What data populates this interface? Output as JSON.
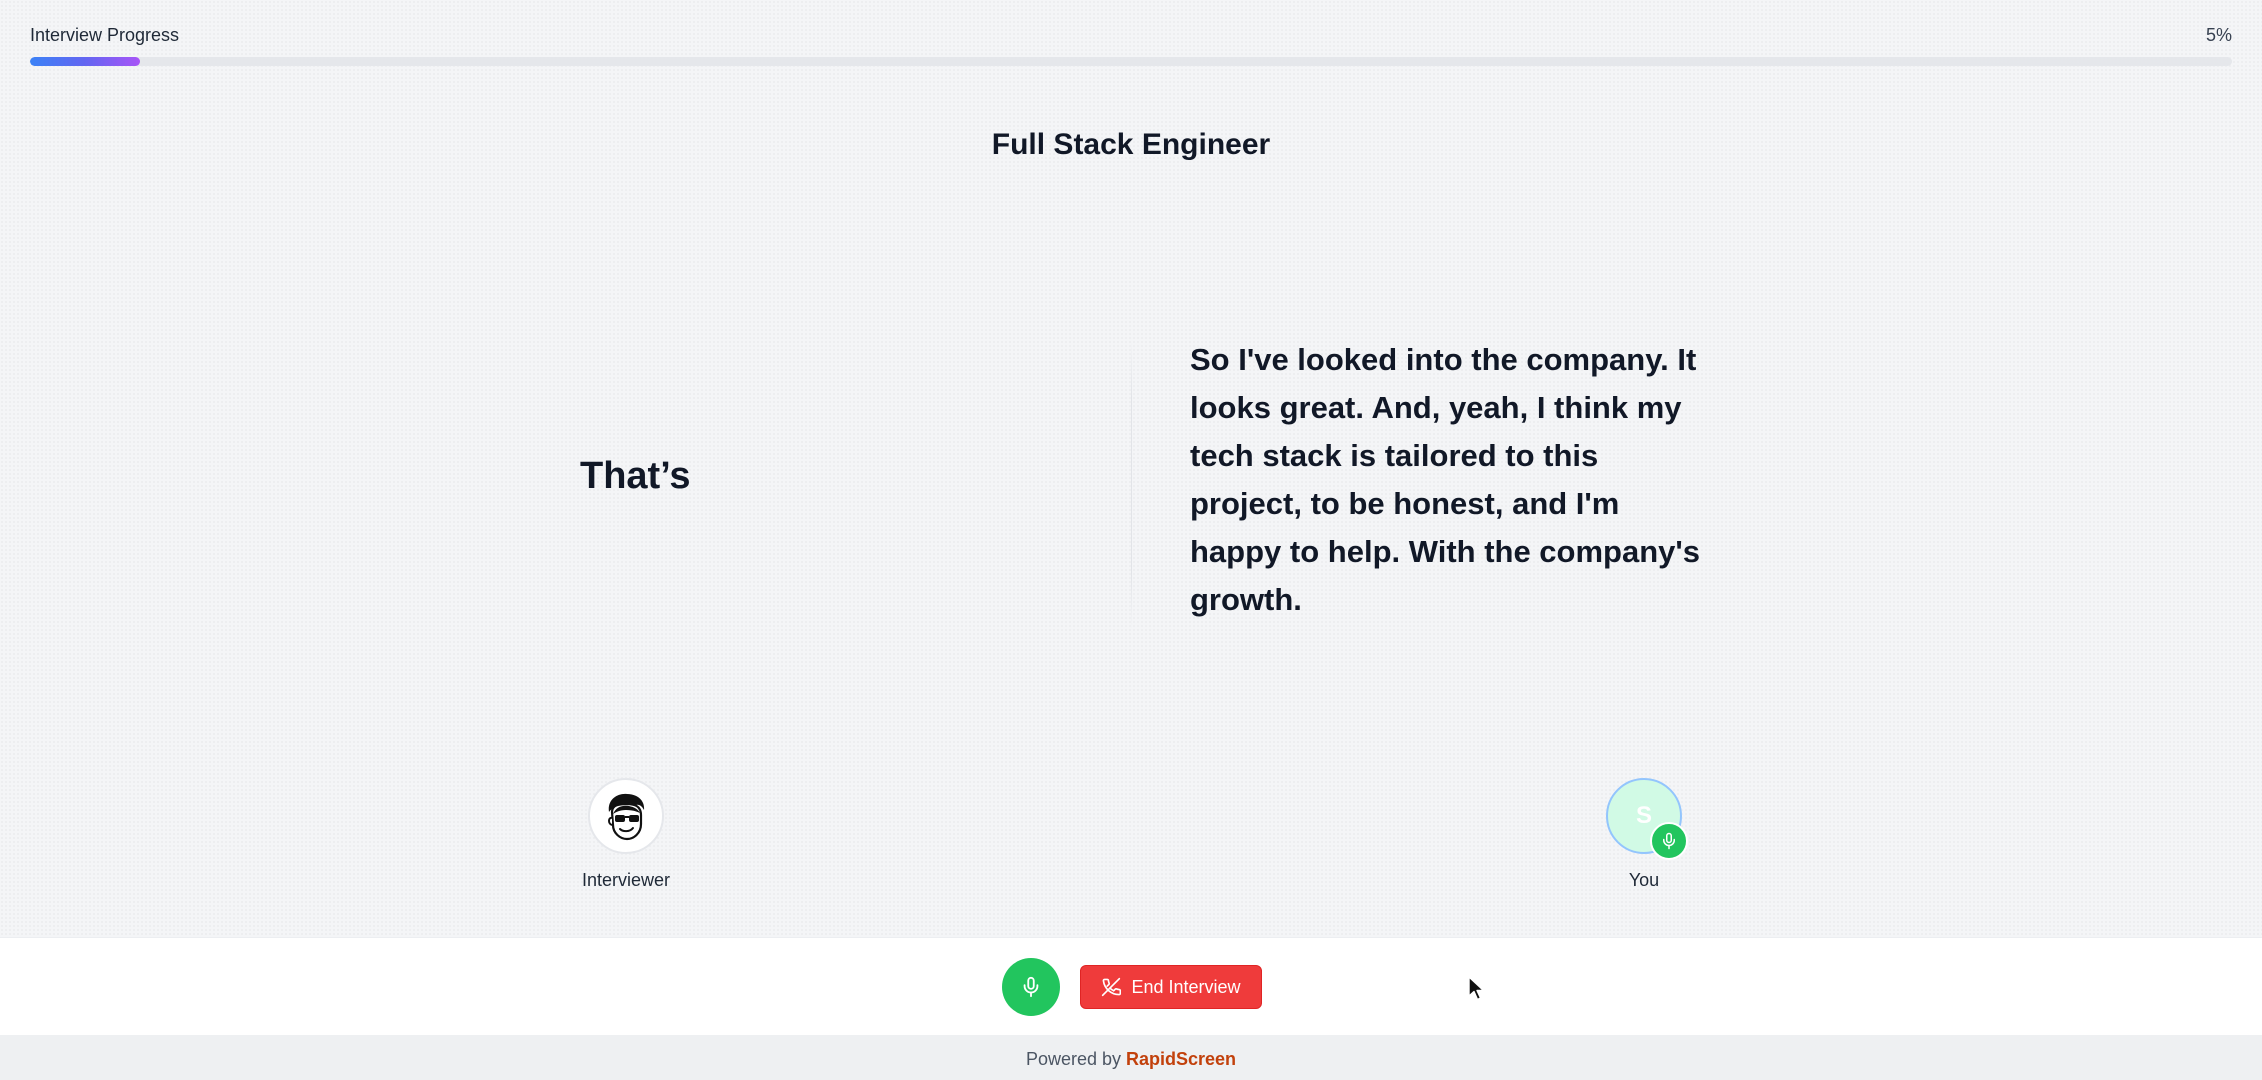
{
  "progress": {
    "label": "Interview Progress",
    "percent_text": "5%",
    "value": 0.05
  },
  "job_title": "Full Stack Engineer",
  "transcript": {
    "interviewer_text": "That’s",
    "candidate_text": "So I've looked into the company. It looks great. And, yeah, I think my tech stack is tailored to this project, to be honest, and I'm happy to help. With the company's growth."
  },
  "participants": {
    "interviewer": {
      "name": "Interviewer",
      "avatar_icon": "cartoon-face-avatar-icon"
    },
    "you": {
      "name": "You",
      "initial": "S",
      "badge_icon": "microphone-icon"
    }
  },
  "controls": {
    "mic_icon": "microphone-icon",
    "end_label": "End Interview",
    "end_icon": "phone-hangup-icon"
  },
  "footer": {
    "prefix": "Powered by",
    "brand": "RapidScreen"
  },
  "colors": {
    "accent_green": "#22c55e",
    "danger_red": "#ef3b3b",
    "brand_orange": "#c2410c",
    "progress_gradient_start": "#3b82f6",
    "progress_gradient_end": "#a855f7"
  }
}
